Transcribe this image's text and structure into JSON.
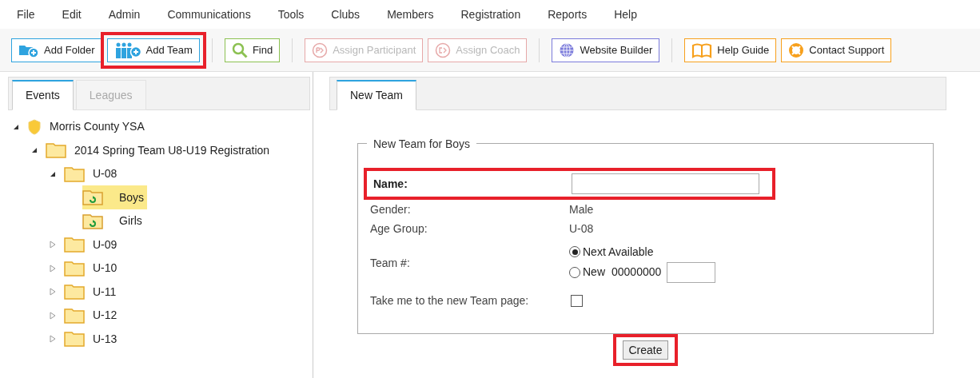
{
  "menu": [
    "File",
    "Edit",
    "Admin",
    "Communications",
    "Tools",
    "Clubs",
    "Members",
    "Registration",
    "Reports",
    "Help"
  ],
  "toolbar": [
    {
      "label": "Add Folder",
      "kind": "folder",
      "color": "#2ea3df",
      "disabled": false,
      "highlighted": false
    },
    {
      "label": "Add Team",
      "kind": "team",
      "color": "#2ea3df",
      "disabled": false,
      "highlighted": true
    },
    {
      "kind": "separator"
    },
    {
      "label": "Find",
      "kind": "search",
      "color": "#8cc152",
      "disabled": false,
      "highlighted": false
    },
    {
      "kind": "separator"
    },
    {
      "label": "Assign Participant",
      "kind": "participant",
      "color": "#e6a8a8",
      "disabled": true,
      "highlighted": false
    },
    {
      "label": "Assign Coach",
      "kind": "coach",
      "color": "#e6a8a8",
      "disabled": true,
      "highlighted": false
    },
    {
      "kind": "separator"
    },
    {
      "label": "Website Builder",
      "kind": "globe",
      "color": "#7b7bdb",
      "disabled": false,
      "highlighted": false
    },
    {
      "kind": "separator"
    },
    {
      "label": "Help Guide",
      "kind": "book",
      "color": "#f7a01c",
      "disabled": false,
      "highlighted": false
    },
    {
      "label": "Contact Support",
      "kind": "lifebuoy",
      "color": "#f7a01c",
      "disabled": false,
      "highlighted": false
    }
  ],
  "left_tabs": [
    {
      "label": "Events",
      "selected": true
    },
    {
      "label": "Leagues",
      "selected": false
    }
  ],
  "tree": [
    {
      "label": "Morris County YSA",
      "kind": "shield",
      "expanded": true,
      "selected": false,
      "children": [
        {
          "label": "2014 Spring Team U8-U19 Registration",
          "kind": "folder",
          "expanded": true,
          "selected": false,
          "children": [
            {
              "label": "U-08",
              "kind": "folder",
              "expanded": true,
              "selected": false,
              "children": [
                {
                  "label": "Boys",
                  "kind": "team-folder",
                  "selected": true
                },
                {
                  "label": "Girls",
                  "kind": "team-folder",
                  "selected": false
                }
              ]
            },
            {
              "label": "U-09",
              "kind": "folder",
              "expanded": false,
              "selected": false
            },
            {
              "label": "U-10",
              "kind": "folder",
              "expanded": false,
              "selected": false
            },
            {
              "label": "U-11",
              "kind": "folder",
              "expanded": false,
              "selected": false
            },
            {
              "label": "U-12",
              "kind": "folder",
              "expanded": false,
              "selected": false
            },
            {
              "label": "U-13",
              "kind": "folder",
              "expanded": false,
              "selected": false
            }
          ]
        }
      ]
    }
  ],
  "right_tabs": [
    {
      "label": "New Team",
      "selected": true
    }
  ],
  "form": {
    "legend": "New Team for Boys",
    "name": {
      "label": "Name:",
      "highlighted": true
    },
    "gender": {
      "label": "Gender:",
      "value": "Male"
    },
    "age_group": {
      "label": "Age Group:",
      "value": "U-08"
    },
    "team_number": {
      "label": "Team #:",
      "options": [
        {
          "label": "Next Available",
          "selected": true
        },
        {
          "label": "New",
          "number": "00000000",
          "selected": false
        }
      ]
    },
    "take_me": {
      "label": "Take me to the new Team page:",
      "checked": false
    },
    "create": {
      "label": "Create",
      "highlighted": true
    }
  }
}
